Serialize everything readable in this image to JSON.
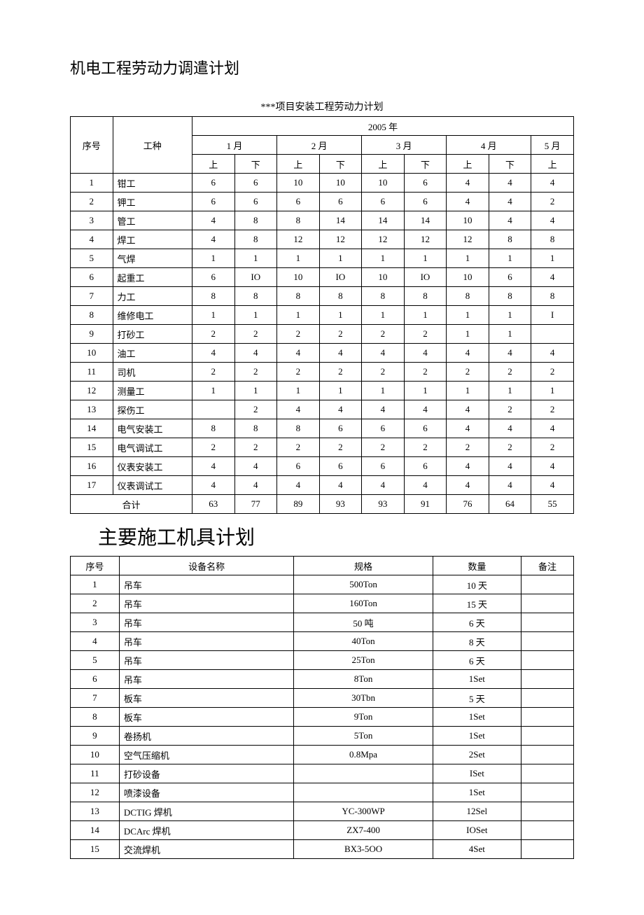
{
  "heading1": "机电工程劳动力调遣计划",
  "subtitle1": "***项目安装工程劳动力计划",
  "table1": {
    "headers": {
      "seq": "序号",
      "type": "工种",
      "year": "2005 年",
      "months": [
        "1 月",
        "2 月",
        "3 月",
        "4 月",
        "5 月"
      ],
      "halves": [
        "上",
        "下",
        "上",
        "下",
        "上",
        "下",
        "上",
        "下",
        "上"
      ]
    },
    "rows": [
      {
        "seq": "1",
        "type": "钳工",
        "v": [
          "6",
          "6",
          "10",
          "10",
          "10",
          "6",
          "4",
          "4",
          "4"
        ]
      },
      {
        "seq": "2",
        "type": "钾工",
        "v": [
          "6",
          "6",
          "6",
          "6",
          "6",
          "6",
          "4",
          "4",
          "2"
        ]
      },
      {
        "seq": "3",
        "type": "管工",
        "v": [
          "4",
          "8",
          "8",
          "14",
          "14",
          "14",
          "10",
          "4",
          "4"
        ]
      },
      {
        "seq": "4",
        "type": "焊工",
        "v": [
          "4",
          "8",
          "12",
          "12",
          "12",
          "12",
          "12",
          "8",
          "8"
        ]
      },
      {
        "seq": "5",
        "type": "气焊",
        "v": [
          "1",
          "1",
          "1",
          "1",
          "1",
          "1",
          "1",
          "1",
          "1"
        ]
      },
      {
        "seq": "6",
        "type": "起重工",
        "v": [
          "6",
          "IO",
          "10",
          "IO",
          "10",
          "IO",
          "10",
          "6",
          "4"
        ]
      },
      {
        "seq": "7",
        "type": "力工",
        "v": [
          "8",
          "8",
          "8",
          "8",
          "8",
          "8",
          "8",
          "8",
          "8"
        ]
      },
      {
        "seq": "8",
        "type": "维修电工",
        "v": [
          "1",
          "1",
          "1",
          "1",
          "1",
          "1",
          "1",
          "1",
          "I"
        ]
      },
      {
        "seq": "9",
        "type": "打砂工",
        "v": [
          "2",
          "2",
          "2",
          "2",
          "2",
          "2",
          "1",
          "1",
          ""
        ]
      },
      {
        "seq": "10",
        "type": "油工",
        "v": [
          "4",
          "4",
          "4",
          "4",
          "4",
          "4",
          "4",
          "4",
          "4"
        ]
      },
      {
        "seq": "11",
        "type": "司机",
        "v": [
          "2",
          "2",
          "2",
          "2",
          "2",
          "2",
          "2",
          "2",
          "2"
        ]
      },
      {
        "seq": "12",
        "type": "测量工",
        "v": [
          "1",
          "1",
          "1",
          "1",
          "1",
          "1",
          "1",
          "1",
          "1"
        ]
      },
      {
        "seq": "13",
        "type": "探伤工",
        "v": [
          "",
          "2",
          "4",
          "4",
          "4",
          "4",
          "4",
          "2",
          "2"
        ]
      },
      {
        "seq": "14",
        "type": "电气安装工",
        "v": [
          "8",
          "8",
          "8",
          "6",
          "6",
          "6",
          "4",
          "4",
          "4"
        ]
      },
      {
        "seq": "15",
        "type": "电气调试工",
        "v": [
          "2",
          "2",
          "2",
          "2",
          "2",
          "2",
          "2",
          "2",
          "2"
        ]
      },
      {
        "seq": "16",
        "type": "仪表安装工",
        "v": [
          "4",
          "4",
          "6",
          "6",
          "6",
          "6",
          "4",
          "4",
          "4"
        ]
      },
      {
        "seq": "17",
        "type": "仪表调试工",
        "v": [
          "4",
          "4",
          "4",
          "4",
          "4",
          "4",
          "4",
          "4",
          "4"
        ]
      }
    ],
    "total": {
      "label": "合计",
      "v": [
        "63",
        "77",
        "89",
        "93",
        "93",
        "91",
        "76",
        "64",
        "55"
      ]
    }
  },
  "heading2": "主要施工机具计划",
  "table2": {
    "headers": {
      "seq": "序号",
      "name": "设备名称",
      "spec": "规格",
      "qty": "数量",
      "notes": "备注"
    },
    "rows": [
      {
        "seq": "1",
        "name": "吊车",
        "spec": "500Ton",
        "qty": "10 天",
        "notes": ""
      },
      {
        "seq": "2",
        "name": "吊车",
        "spec": "160Ton",
        "qty": "15 天",
        "notes": ""
      },
      {
        "seq": "3",
        "name": "吊车",
        "spec": "50 吨",
        "qty": "6 天",
        "notes": ""
      },
      {
        "seq": "4",
        "name": "吊车",
        "spec": "40Ton",
        "qty": "8 天",
        "notes": ""
      },
      {
        "seq": "5",
        "name": "吊车",
        "spec": "25Ton",
        "qty": "6 天",
        "notes": ""
      },
      {
        "seq": "6",
        "name": "吊车",
        "spec": "8Ton",
        "qty": "1Set",
        "notes": ""
      },
      {
        "seq": "7",
        "name": "板车",
        "spec": "30Tbn",
        "qty": "5 天",
        "notes": ""
      },
      {
        "seq": "8",
        "name": "板车",
        "spec": "9Ton",
        "qty": "1Set",
        "notes": ""
      },
      {
        "seq": "9",
        "name": "卷扬机",
        "spec": "5Ton",
        "qty": "1Set",
        "notes": ""
      },
      {
        "seq": "10",
        "name": "空气压缩机",
        "spec": "0.8Mpa",
        "qty": "2Set",
        "notes": ""
      },
      {
        "seq": "11",
        "name": "打砂设备",
        "spec": "",
        "qty": "ISet",
        "notes": ""
      },
      {
        "seq": "12",
        "name": "喷漆设备",
        "spec": "",
        "qty": "1Set",
        "notes": ""
      },
      {
        "seq": "13",
        "name": "DCTIG 焊机",
        "spec": "YC-300WP",
        "qty": "12Sel",
        "notes": ""
      },
      {
        "seq": "14",
        "name": "DCArc 焊机",
        "spec": "ZX7-400",
        "qty": "IOSet",
        "notes": ""
      },
      {
        "seq": "15",
        "name": "交流焊机",
        "spec": "BX3-5OO",
        "qty": "4Set",
        "notes": ""
      }
    ]
  }
}
